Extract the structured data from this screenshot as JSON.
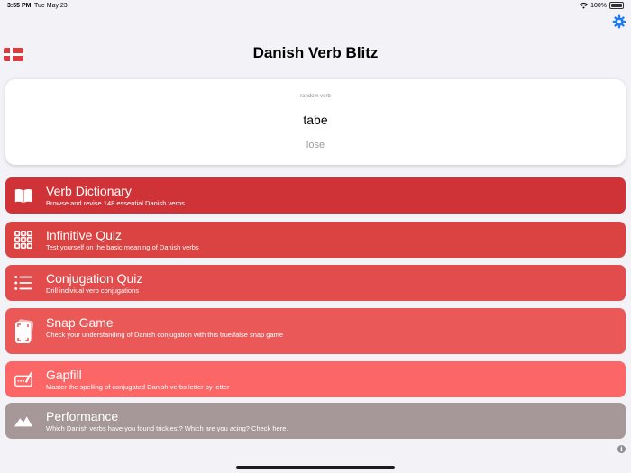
{
  "status_bar": {
    "time": "3:55 PM",
    "date": "Tue May 23",
    "battery": "100%"
  },
  "header": {
    "title": "Danish Verb Blitz"
  },
  "random_verb": {
    "caption": "random verb",
    "word": "tabe",
    "translation": "lose"
  },
  "menu": [
    {
      "title": "Verb Dictionary",
      "subtitle": "Browse and revise 148 essential Danish verbs",
      "icon": "book-icon",
      "color": "#cf3337"
    },
    {
      "title": "Infinitive Quiz",
      "subtitle": "Test yourself on the basic meaning of Danish verbs",
      "icon": "grid-icon",
      "color": "#db4242"
    },
    {
      "title": "Conjugation Quiz",
      "subtitle": "Drill indiviual verb conjugations",
      "icon": "list-icon",
      "color": "#e34c4c"
    },
    {
      "title": "Snap Game",
      "subtitle": "Check your understanding of Danish conjugation with this true/false snap game",
      "icon": "cards-icon",
      "color": "#ea5858"
    },
    {
      "title": "Gapfill",
      "subtitle": "Master the spelling of conjugated Danish verbs letter by letter",
      "icon": "pencil-field-icon",
      "color": "#fd6666"
    },
    {
      "title": "Performance",
      "subtitle": "Which Danish verbs have you found trickiest? Which are you acing? Check here.",
      "icon": "mountain-chart-icon",
      "color": "#a69898"
    }
  ],
  "colors": {
    "settings": "#1e7cf2",
    "flag_red": "#e03a3e"
  }
}
